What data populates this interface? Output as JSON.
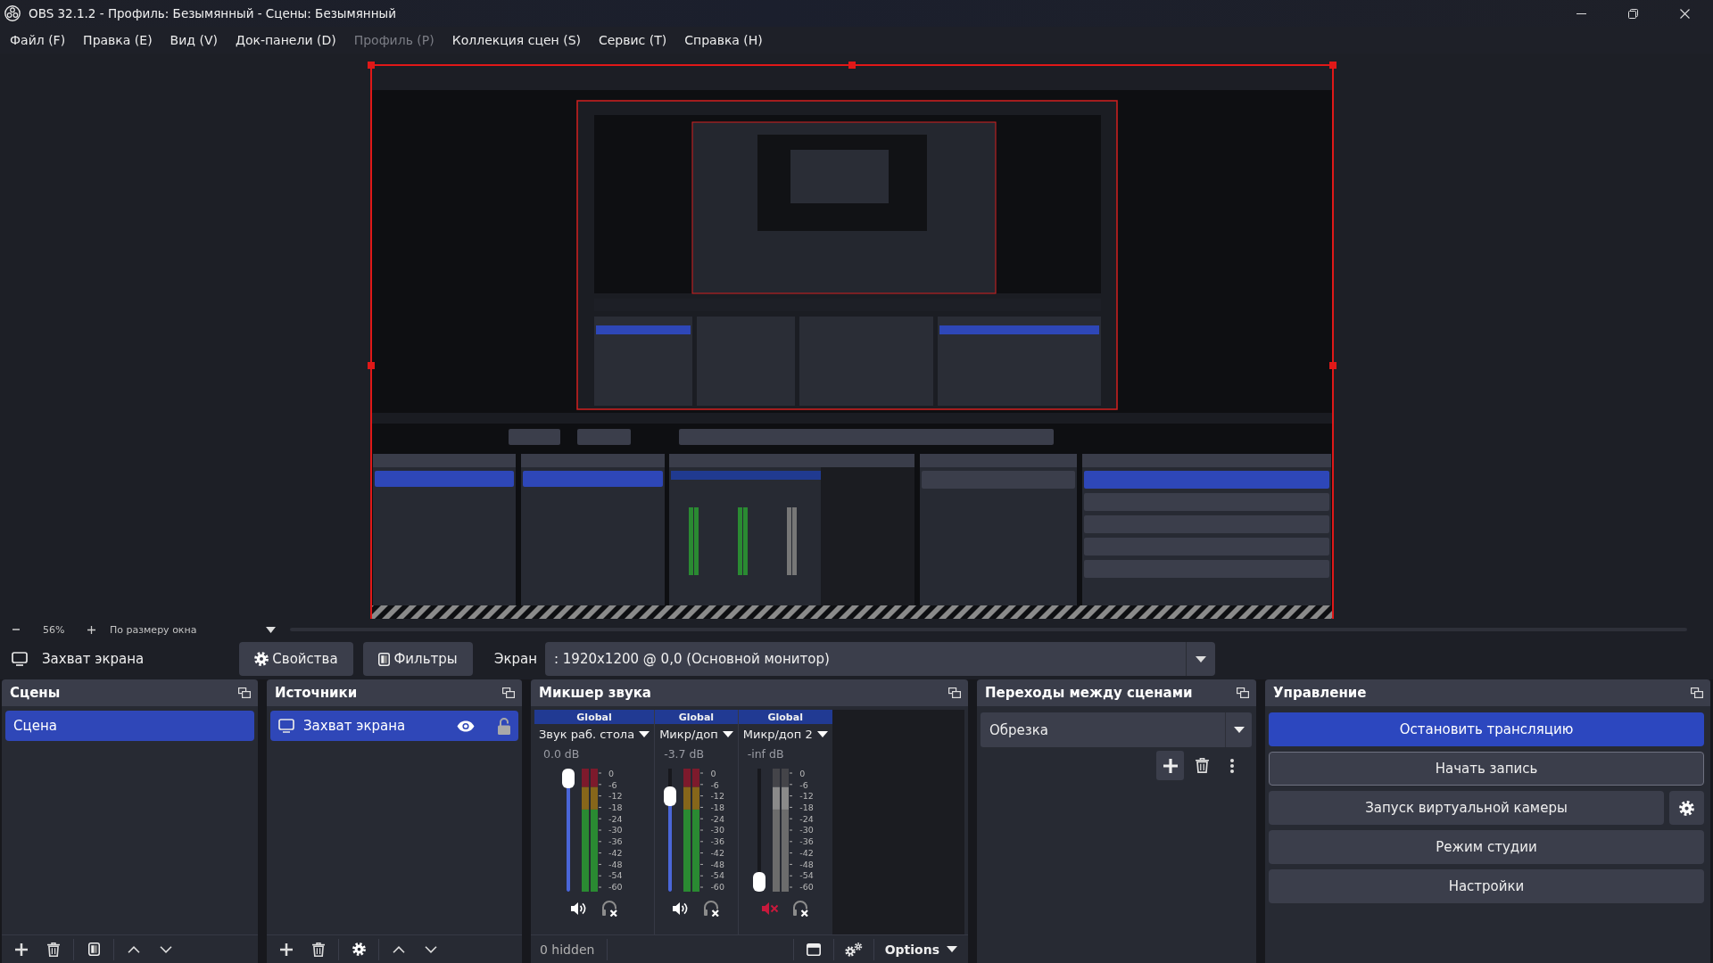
{
  "window": {
    "title": "OBS 32.1.2 - Профиль: Безымянный - Сцены: Безымянный"
  },
  "menu": [
    {
      "label": "Файл (F)",
      "disabled": false
    },
    {
      "label": "Правка (E)",
      "disabled": false
    },
    {
      "label": "Вид (V)",
      "disabled": false
    },
    {
      "label": "Док-панели (D)",
      "disabled": false
    },
    {
      "label": "Профиль (P)",
      "disabled": true
    },
    {
      "label": "Коллекция сцен (S)",
      "disabled": false
    },
    {
      "label": "Сервис (T)",
      "disabled": false
    },
    {
      "label": "Справка (H)",
      "disabled": false
    }
  ],
  "zoom_bar": {
    "percent": "56%",
    "fit_mode": "По размеру окна"
  },
  "source_toolbar": {
    "source": "Захват экрана",
    "buttons": [
      {
        "kind": "properties",
        "label": "Свойства"
      },
      {
        "kind": "filters",
        "label": "Фильтры"
      }
    ],
    "display_label": "Экран",
    "display_value": ": 1920x1200 @ 0,0 (Основной монитор)"
  },
  "scenes": {
    "title": "Сцены",
    "items": [
      {
        "label": "Сцена",
        "selected": true
      }
    ]
  },
  "sources": {
    "title": "Источники",
    "items": [
      {
        "label": "Захват экрана",
        "selected": true,
        "visible": true,
        "locked": false
      }
    ]
  },
  "audio_mixer": {
    "title": "Микшер звука",
    "channels": [
      {
        "group": "Global",
        "name": "Звук раб. стола",
        "reading": "0.0 dB",
        "level": 1,
        "muted": false,
        "scale": [
          "0",
          "-6",
          "-12",
          "-18",
          "-24",
          "-30",
          "-36",
          "-42",
          "-48",
          "-54",
          "-60"
        ]
      },
      {
        "group": "Global",
        "name": "Микр/доп",
        "reading": "-3.7 dB",
        "level": 0.83,
        "muted": false,
        "scale": [
          "0",
          "-6",
          "-12",
          "-18",
          "-24",
          "-30",
          "-36",
          "-42",
          "-48",
          "-54",
          "-60"
        ]
      },
      {
        "group": "Global",
        "name": "Микр/доп 2",
        "reading": "-inf dB",
        "level": 0,
        "muted": true,
        "scale": [
          "0",
          "-6",
          "-12",
          "-18",
          "-24",
          "-30",
          "-36",
          "-42",
          "-48",
          "-54",
          "-60"
        ]
      }
    ],
    "hidden_count": "0 hidden",
    "options": "Options"
  },
  "transitions": {
    "title": "Переходы между сценами",
    "transition": "Обрезка"
  },
  "controls": {
    "title": "Управление",
    "buttons": [
      {
        "label": "Остановить трансляцию",
        "kind": "plain",
        "active": true,
        "focused": false
      },
      {
        "label": "Начать запись",
        "kind": "plain",
        "active": false,
        "focused": true
      },
      {
        "label": "Запуск виртуальной камеры",
        "kind": "with_settings",
        "active": false,
        "focused": false
      },
      {
        "label": "Режим студии",
        "kind": "plain",
        "active": false,
        "focused": false
      },
      {
        "label": "Настройки",
        "kind": "plain",
        "active": false,
        "focused": false
      }
    ]
  }
}
